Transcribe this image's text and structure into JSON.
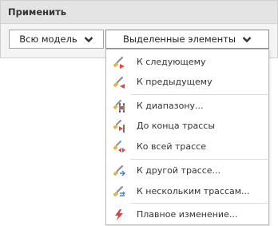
{
  "panel": {
    "title": "Применить"
  },
  "buttons": {
    "all_model": "Всю модель",
    "selected_elements": "Выделенные элементы"
  },
  "menu": {
    "groups": [
      [
        {
          "label": "К следующему",
          "icon": "brush-next-icon"
        },
        {
          "label": "К предыдущему",
          "icon": "brush-previous-icon"
        }
      ],
      [
        {
          "label": "К диапазону...",
          "icon": "brush-range-icon"
        },
        {
          "label": "До конца трассы",
          "icon": "brush-to-end-icon"
        },
        {
          "label": "Ко всей трассе",
          "icon": "brush-whole-route-icon"
        }
      ],
      [
        {
          "label": "К другой трассе...",
          "icon": "brush-other-route-icon"
        },
        {
          "label": "К нескольким трассам...",
          "icon": "brush-multiple-routes-icon"
        }
      ],
      [
        {
          "label": "Плавное изменение...",
          "icon": "lightning-icon"
        }
      ]
    ]
  },
  "colors": {
    "brush_tip": "#e0b84a",
    "brush_handle": "#8a8fa0",
    "accent_red": "#e84545",
    "lightning": "#e03c3c"
  }
}
